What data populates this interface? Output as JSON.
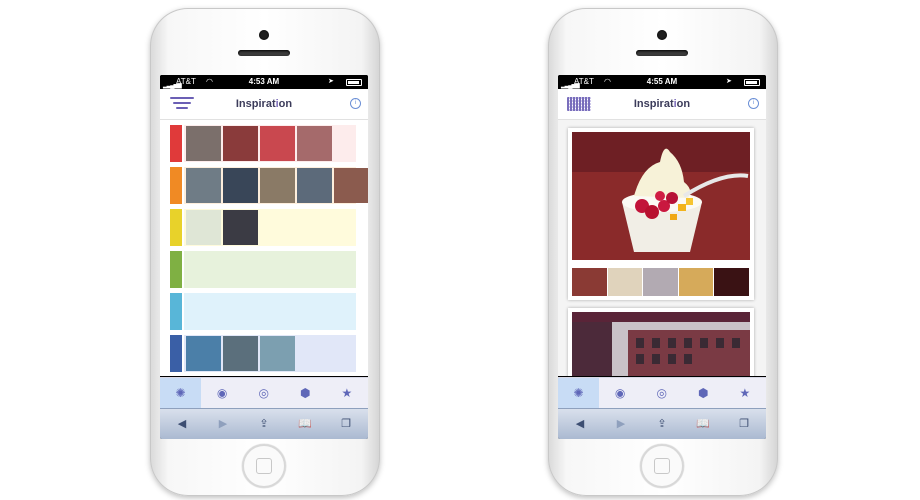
{
  "left_phone": {
    "status": {
      "carrier": "AT&T",
      "time": "4:53 AM"
    },
    "header": {
      "title_main": "Inspirat",
      "title_hl": "i",
      "title_end": "on"
    },
    "rows": [
      {
        "color": "#e03a3a",
        "band": "#fdecec",
        "thumbs": [
          "#7b6f6b",
          "#8a3b3b",
          "#c9484f",
          "#a56a6b"
        ]
      },
      {
        "color": "#f08a24",
        "band": "#fdeedc",
        "thumbs": [
          "#6f7c86",
          "#394658",
          "#8a7a66",
          "#5c6a7a",
          "#8b5b4e"
        ]
      },
      {
        "color": "#e8d22a",
        "band": "#fffbdc",
        "thumbs": [
          "#dfe6d6",
          "#3b3b44"
        ]
      },
      {
        "color": "#7fb043",
        "band": "#e7f2dc",
        "thumbs": []
      },
      {
        "color": "#58b6d8",
        "band": "#dff2fb",
        "thumbs": []
      },
      {
        "color": "#3a5fa6",
        "band": "#e1e7f8",
        "thumbs": [
          "#4b7fa8",
          "#5b6f7c",
          "#7c9fb0"
        ]
      }
    ],
    "tabs": [
      {
        "icon": "sparkle-icon",
        "glyph": "✺",
        "active": true
      },
      {
        "icon": "eye-icon",
        "glyph": "◉",
        "active": false
      },
      {
        "icon": "pin-icon",
        "glyph": "◎",
        "active": false
      },
      {
        "icon": "tag-icon",
        "glyph": "⬢",
        "active": false
      },
      {
        "icon": "star-icon",
        "glyph": "★",
        "active": false
      }
    ]
  },
  "right_phone": {
    "status": {
      "carrier": "AT&T",
      "time": "4:55 AM"
    },
    "header": {
      "title_main": "Inspirat",
      "title_hl": "i",
      "title_end": "on"
    },
    "palette": [
      "#8a3a34",
      "#e0d3bc",
      "#b2aab2",
      "#d6aa5a",
      "#3a1214"
    ],
    "tabs": [
      {
        "icon": "sparkle-icon",
        "glyph": "✺",
        "active": true
      },
      {
        "icon": "eye-icon",
        "glyph": "◉",
        "active": false
      },
      {
        "icon": "pin-icon",
        "glyph": "◎",
        "active": false
      },
      {
        "icon": "tag-icon",
        "glyph": "⬢",
        "active": false
      },
      {
        "icon": "star-icon",
        "glyph": "★",
        "active": false
      }
    ]
  },
  "browser_toolbar": [
    {
      "icon": "back-arrow-icon",
      "glyph": "◀",
      "disabled": false
    },
    {
      "icon": "forward-arrow-icon",
      "glyph": "▶",
      "disabled": true
    },
    {
      "icon": "share-icon",
      "glyph": "⇪",
      "disabled": false
    },
    {
      "icon": "bookmarks-icon",
      "glyph": "📖",
      "disabled": false
    },
    {
      "icon": "tabs-icon",
      "glyph": "❐",
      "disabled": false
    }
  ]
}
